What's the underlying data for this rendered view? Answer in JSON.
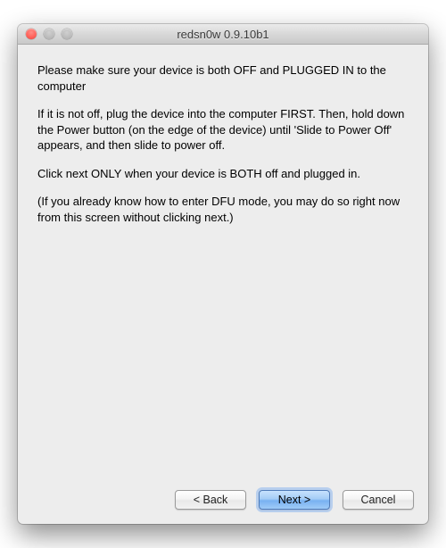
{
  "window": {
    "title": "redsn0w 0.9.10b1"
  },
  "content": {
    "p1": "Please make sure your device is both OFF and PLUGGED IN to the computer",
    "p2": "If it is not off, plug the device into the computer FIRST. Then, hold down the Power button (on the edge of the device) until 'Slide to Power Off' appears, and then slide to power off.",
    "p3": "Click next ONLY when your device is BOTH off and plugged in.",
    "p4": "(If you already know how to enter DFU mode, you may do so right now from this screen without clicking next.)"
  },
  "buttons": {
    "back": "< Back",
    "next": "Next >",
    "cancel": "Cancel"
  }
}
